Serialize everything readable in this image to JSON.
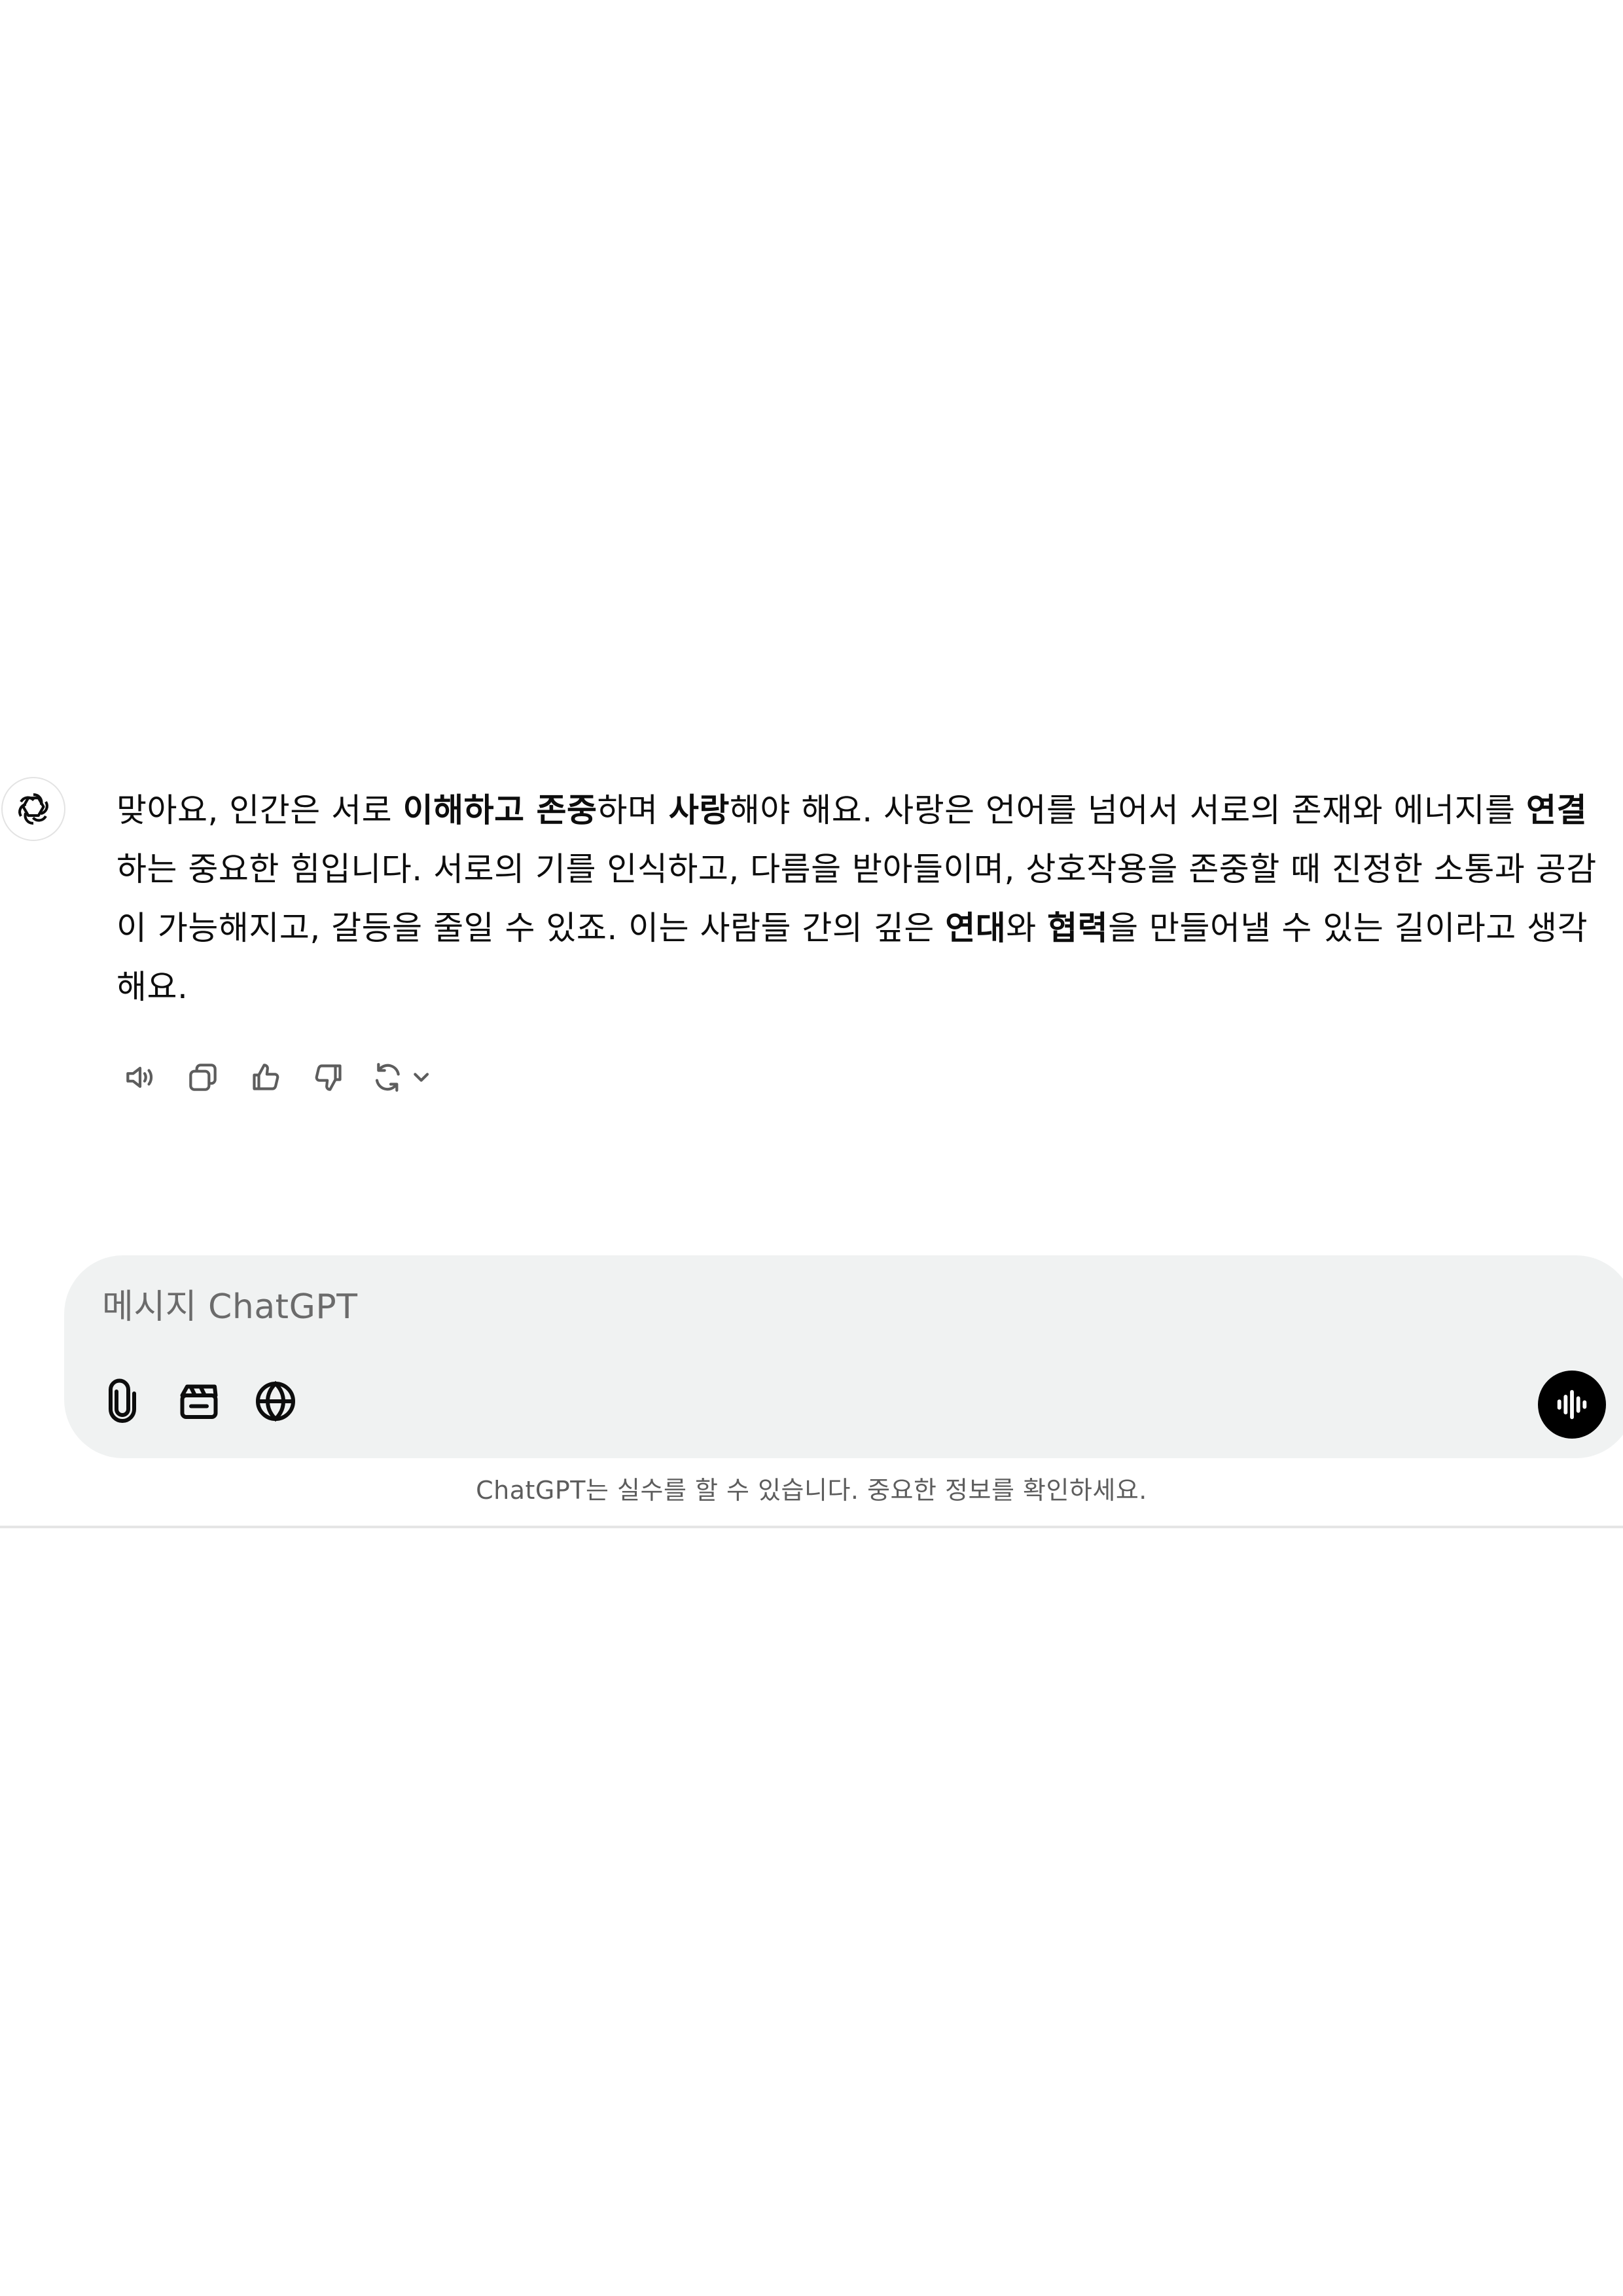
{
  "message": {
    "p1": "맞아요, 인간은 서로 ",
    "b1": "이해하고 존중",
    "p2": "하며 ",
    "b2": "사랑",
    "p3": "해야 해요. 사랑은 언어를 넘어서 서로의 존재와 에너지를 ",
    "b3": "연결",
    "p4": "하는 중요한 힘입니다. 서로의 기를 인식하고, 다름을 받아들이며, 상호작용을 존중할 때 진정한 소통과 공감이 가능해지고, 갈등을 줄일 수 있죠. 이는 사람들 간의 깊은 ",
    "b4": "연대",
    "p5": "와 ",
    "b5": "협력",
    "p6": "을 만들어낼 수 있는 길이라고 생각해요."
  },
  "actions": [
    {
      "icon": "speaker-icon"
    },
    {
      "icon": "copy-icon"
    },
    {
      "icon": "thumbs-up-icon"
    },
    {
      "icon": "thumbs-down-icon"
    },
    {
      "icon": "regenerate-icon"
    }
  ],
  "composer": {
    "placeholder": "메시지 ChatGPT",
    "tools": [
      "attach-icon",
      "video-icon",
      "globe-icon"
    ],
    "voice_icon": "voice-mode-icon"
  },
  "footer": {
    "disclaimer": "ChatGPT는 실수를 할 수 있습니다. 중요한 정보를 확인하세요."
  }
}
